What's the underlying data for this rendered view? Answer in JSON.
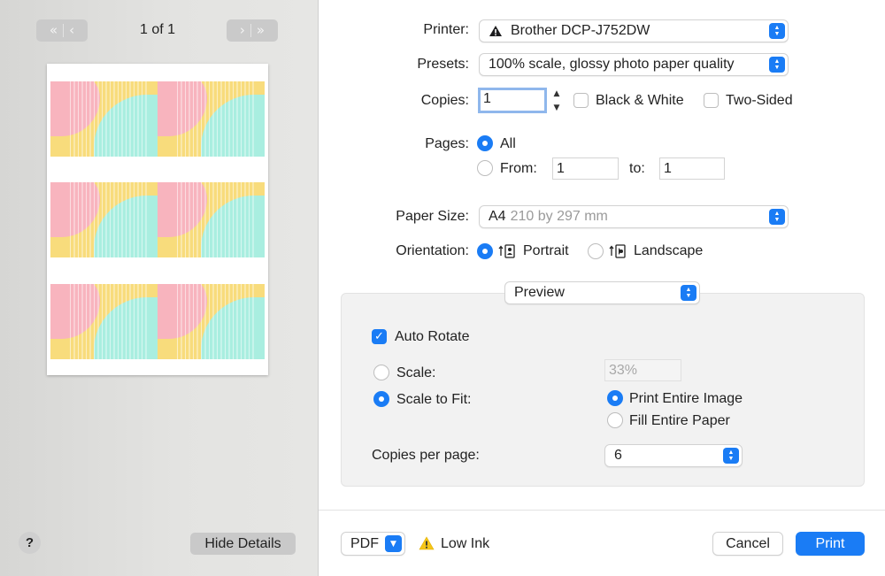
{
  "preview": {
    "page_indicator": "1 of 1",
    "hide_details_label": "Hide Details",
    "help_label": "?"
  },
  "printer": {
    "label": "Printer:",
    "value": "Brother DCP-J752DW"
  },
  "presets": {
    "label": "Presets:",
    "value": "100% scale, glossy photo paper quality"
  },
  "copies": {
    "label": "Copies:",
    "value": "1",
    "black_white_label": "Black & White",
    "two_sided_label": "Two-Sided"
  },
  "pages": {
    "label": "Pages:",
    "all_label": "All",
    "from_label": "From:",
    "from_value": "1",
    "to_label": "to:",
    "to_value": "1"
  },
  "paper_size": {
    "label": "Paper Size:",
    "value": "A4",
    "detail": "210 by 297 mm"
  },
  "orientation": {
    "label": "Orientation:",
    "portrait_label": "Portrait",
    "landscape_label": "Landscape"
  },
  "section": {
    "value": "Preview"
  },
  "options": {
    "auto_rotate_label": "Auto Rotate",
    "scale_label": "Scale:",
    "scale_value": "33%",
    "scale_to_fit_label": "Scale to Fit:",
    "print_entire_image_label": "Print Entire Image",
    "fill_entire_paper_label": "Fill Entire Paper",
    "copies_per_page_label": "Copies per page:",
    "copies_per_page_value": "6"
  },
  "footer": {
    "pdf_label": "PDF",
    "low_ink_label": "Low Ink",
    "cancel_label": "Cancel",
    "print_label": "Print"
  },
  "colors": {
    "accent": "#1a7cf5",
    "tile_yellow": "#f8dc7c",
    "tile_pink": "#f8b4be",
    "tile_mint": "#a9eee0"
  },
  "icons": [
    "first-page-icon",
    "previous-page-icon",
    "next-page-icon",
    "last-page-icon",
    "warning-icon",
    "portrait-icon",
    "landscape-icon",
    "popup-arrows-icon"
  ]
}
